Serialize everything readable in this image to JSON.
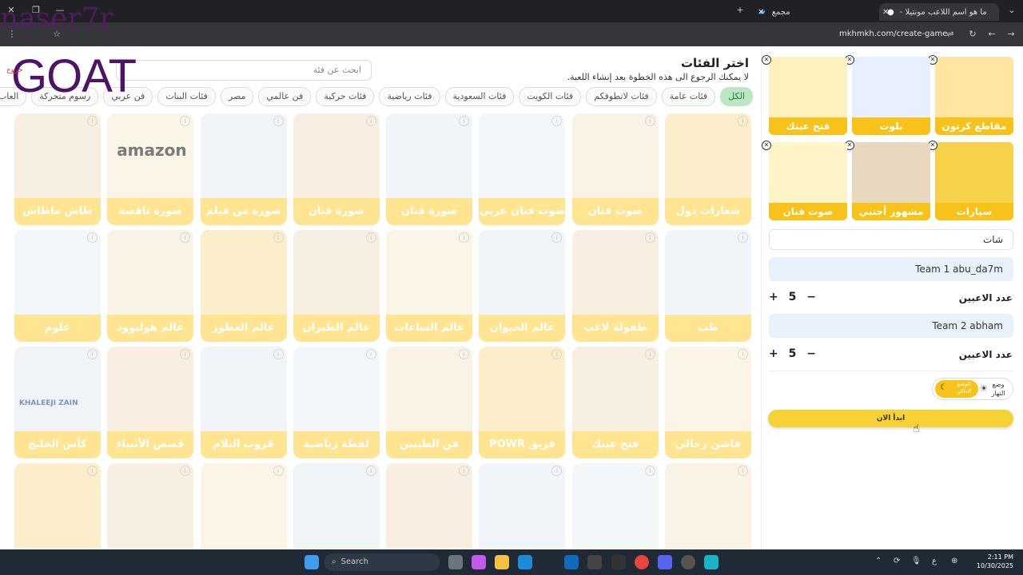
{
  "browser": {
    "tabs": [
      {
        "label": "مجمع",
        "active": false
      },
      {
        "label": "ما هو اسم اللاعب مونتيلا - earch",
        "active": true
      }
    ],
    "url": "mkhmkh.com/create-game"
  },
  "watermark": {
    "line1": "naser7r",
    "line2": "GOAT"
  },
  "header": {
    "logout": "خروج",
    "title": "اختر الفئات",
    "subtitle": "لا يمكنك الرجوع الى هذه الخطوة بعد إنشاء اللعبة.",
    "search_placeholder": "ابحث عن فئة"
  },
  "chips": [
    "الكل",
    "فئات عامة",
    "فئات لاتطوفكم",
    "فئات الكويت",
    "فئات السعودية",
    "فئات رياضية",
    "فئات حركية",
    "فن عالمي",
    "مصر",
    "فئات البنات",
    "فن عربي",
    "رسوم متحركة",
    "العاب إلكترونية"
  ],
  "cards": [
    [
      "شعارات دول",
      "صوت فنان أجنبي",
      "صوت فنان عربي",
      "صورة فنان أجنبي",
      "صورة فنان عربي",
      "صورة من فيلم",
      "صورة ناقصة",
      "طاش ماطاش"
    ],
    [
      "طب",
      "طفولة لاعب",
      "عالم الحيوان",
      "عالم الساعات",
      "عالم الطيران",
      "عالم العطور",
      "عالم هوليوود",
      "علوم"
    ],
    [
      "فاشن رجالي",
      "فتح عينك",
      "فريق POWR",
      "فن الطيبين",
      "لقطة رياضية",
      "قروب البلام",
      "قصص الأنبياء",
      "كأس الخليج"
    ],
    [
      "",
      "",
      "",
      "",
      "",
      "",
      "",
      ""
    ]
  ],
  "card_logo_text": {
    "amazon": "amazon",
    "khaleeji": "KHALEEJI ZAIN"
  },
  "selected": [
    "مقاطع كرتون",
    "بلوت",
    "فتح عينك",
    "سيارات",
    "مشهور أجنبي",
    "صوت فنان عربي"
  ],
  "panel": {
    "game_name": "شات",
    "team1": "Team 1 abu_da7m",
    "team2": "Team 2 abham",
    "players_label": "عدد الاعبين",
    "team1_players": "5",
    "team2_players": "5",
    "mode_day": "وضع النهار",
    "mode_dark": "الوضع الداكن",
    "start": "ابدأ الان"
  },
  "taskbar": {
    "search": "Search",
    "time": "2:11 PM",
    "date": "10/30/2025"
  },
  "colors": {
    "accent": "#f7c21a",
    "label_yellow": "#ffd54a",
    "chip_active": "#bde6c5",
    "team_bg": "#e9f1fb"
  }
}
